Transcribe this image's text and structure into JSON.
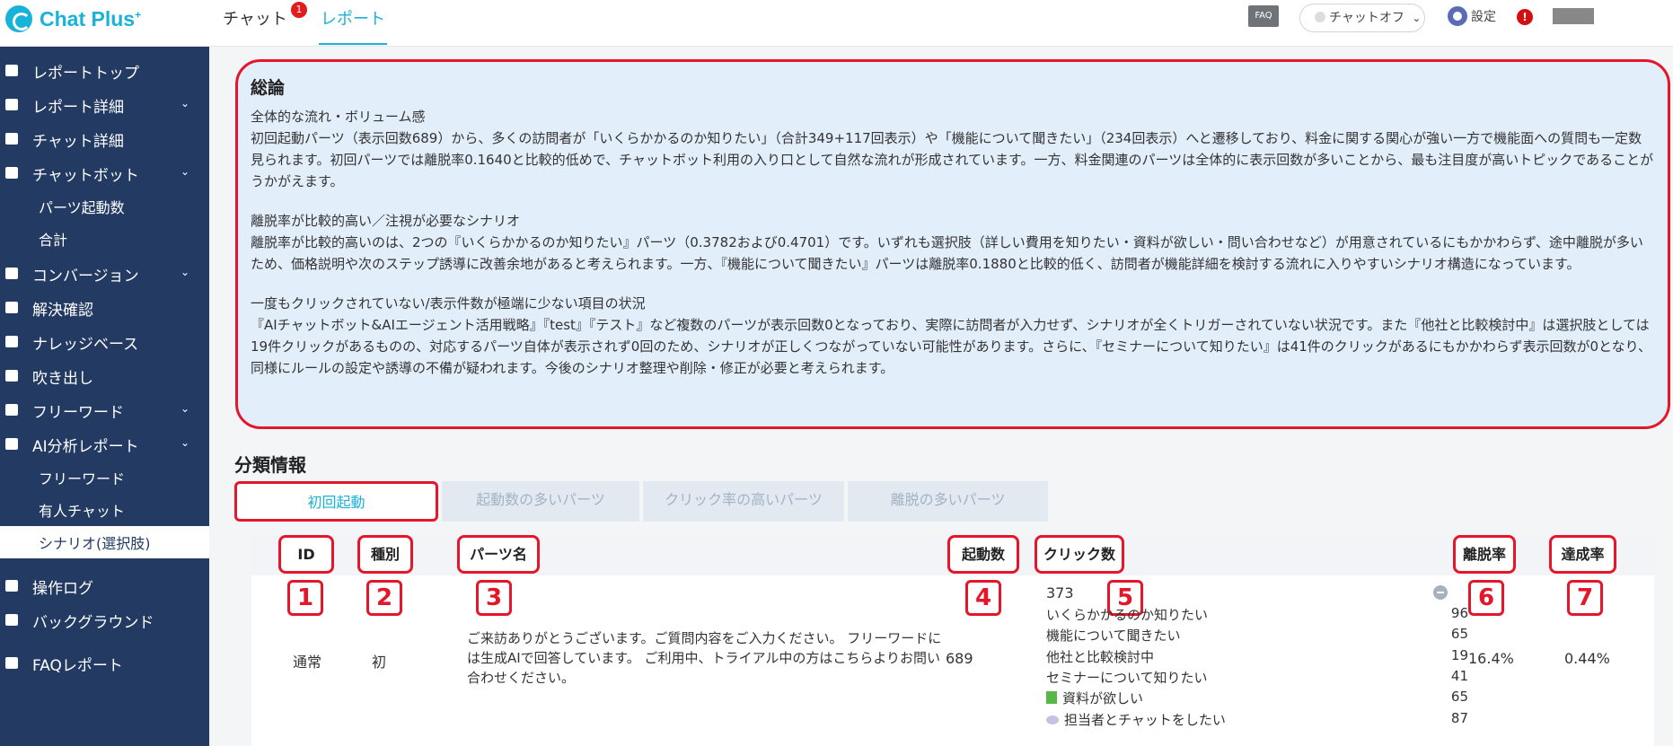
{
  "app": {
    "logo": "Chat Plus",
    "logo_sup": "+",
    "tabs": [
      {
        "label": "チャット",
        "badge": "1"
      },
      {
        "label": "レポート"
      }
    ],
    "faq": "FAQ",
    "chat_status": "チャットオフ",
    "chat_status_chevron": "⌄",
    "settings": "設定",
    "alert": "!"
  },
  "sidebar": {
    "items": [
      {
        "label": "レポートトップ",
        "icon": "dashboard-icon",
        "chevron": ""
      },
      {
        "label": "レポート詳細",
        "icon": "report-icon",
        "chevron": "⌄"
      },
      {
        "label": "チャット詳細",
        "icon": "chat-icon",
        "chevron": ""
      },
      {
        "label": "チャットボット",
        "icon": "bot-icon",
        "chevron": "⌄"
      },
      {
        "label": "パーツ起動数",
        "sub": true
      },
      {
        "label": "合計",
        "sub": true
      },
      {
        "label": "コンバージョン",
        "icon": "star-icon",
        "chevron": "⌄"
      },
      {
        "label": "解決確認",
        "icon": "pin-icon",
        "chevron": ""
      },
      {
        "label": "ナレッジベース",
        "icon": "book-icon",
        "chevron": ""
      },
      {
        "label": "吹き出し",
        "icon": "speech-icon",
        "chevron": ""
      },
      {
        "label": "フリーワード",
        "icon": "text-icon",
        "chevron": "⌄"
      },
      {
        "label": "AI分析レポート",
        "icon": "pin-icon",
        "chevron": "⌄"
      },
      {
        "label": "フリーワード",
        "sub": true
      },
      {
        "label": "有人チャット",
        "sub": true
      },
      {
        "label": "シナリオ(選択肢)",
        "sub": true,
        "active": true
      },
      {
        "label": "操作ログ",
        "icon": "list-icon",
        "chevron": ""
      },
      {
        "label": "バックグラウンド",
        "icon": "background-icon",
        "chevron": ""
      },
      {
        "label": "FAQレポート",
        "icon": "faq-icon",
        "chevron": ""
      }
    ]
  },
  "summary": {
    "title": "総論",
    "p1_head": "全体的な流れ・ボリューム感",
    "p1_body": "初回起動パーツ（表示回数689）から、多くの訪問者が「いくらかかるのか知りたい」（合計349+117回表示）や「機能について聞きたい」（234回表示）へと遷移しており、料金に関する関心が強い一方で機能面への質問も一定数見られます。初回パーツでは離脱率0.1640と比較的低めで、チャットボット利用の入り口として自然な流れが形成されています。一方、料金関連のパーツは全体的に表示回数が多いことから、最も注目度が高いトピックであることがうかがえます。",
    "p2_head": "離脱率が比較的高い／注視が必要なシナリオ",
    "p2_body": "離脱率が比較的高いのは、2つの『いくらかかるのか知りたい』パーツ（0.3782および0.4701）です。いずれも選択肢（詳しい費用を知りたい・資料が欲しい・問い合わせなど）が用意されているにもかかわらず、途中離脱が多いため、価格説明や次のステップ誘導に改善余地があると考えられます。一方、『機能について聞きたい』パーツは離脱率0.1880と比較的低く、訪問者が機能詳細を検討する流れに入りやすいシナリオ構造になっています。",
    "p3_head": "一度もクリックされていない/表示件数が極端に少ない項目の状況",
    "p3_body": "『AIチャットボット&AIエージェント活用戦略』『test』『テスト』など複数のパーツが表示回数0となっており、実際に訪問者が入力せず、シナリオが全くトリガーされていない状況です。また『他社と比較検討中』は選択肢としては19件クリックがあるものの、対応するパーツ自体が表示されず0回のため、シナリオが正しくつながっていない可能性があります。さらに、『セミナーについて知りたい』は41件のクリックがあるにもかかわらず表示回数が0となり、同様にルールの設定や誘導の不備が疑われます。今後のシナリオ整理や削除・修正が必要と考えられます。"
  },
  "classification": {
    "title": "分類情報",
    "tabs": [
      "初回起動",
      "起動数の多いパーツ",
      "クリック率の高いパーツ",
      "離脱の多いパーツ"
    ],
    "headers": [
      "ID",
      "種別",
      "パーツ名",
      "起動数",
      "クリック数",
      "離脱率",
      "達成率"
    ],
    "markers": [
      "1",
      "2",
      "3",
      "4",
      "5",
      "6",
      "7"
    ],
    "row": {
      "id": "通常",
      "type": "初",
      "parts_name": "ご来訪ありがとうございます。ご質問内容をご入力ください。 フリーワードには生成AIで回答しています。 ご利用中、トライアル中の方はこちらよりお問い合わせください。",
      "launches": "689",
      "clicks_total": "373",
      "click_items": [
        {
          "label": "いくらかかるのか知りたい",
          "count": "96",
          "icon": ""
        },
        {
          "label": "機能について聞きたい",
          "count": "65",
          "icon": ""
        },
        {
          "label": "他社と比較検討中",
          "count": "19",
          "icon": ""
        },
        {
          "label": "セミナーについて知りたい",
          "count": "41",
          "icon": ""
        },
        {
          "label": "資料が欲しい",
          "count": "65",
          "icon": "book-icon"
        },
        {
          "label": "担当者とチャットをしたい",
          "count": "87",
          "icon": "bubble-icon"
        }
      ],
      "bounce_rate": "16.4%",
      "achievement_rate": "0.44%"
    }
  },
  "colors": {
    "accent": "#19b2d9",
    "sidebar": "#233a63",
    "highlight_red": "#e5152a",
    "summary_bg": "#e3eefb"
  }
}
